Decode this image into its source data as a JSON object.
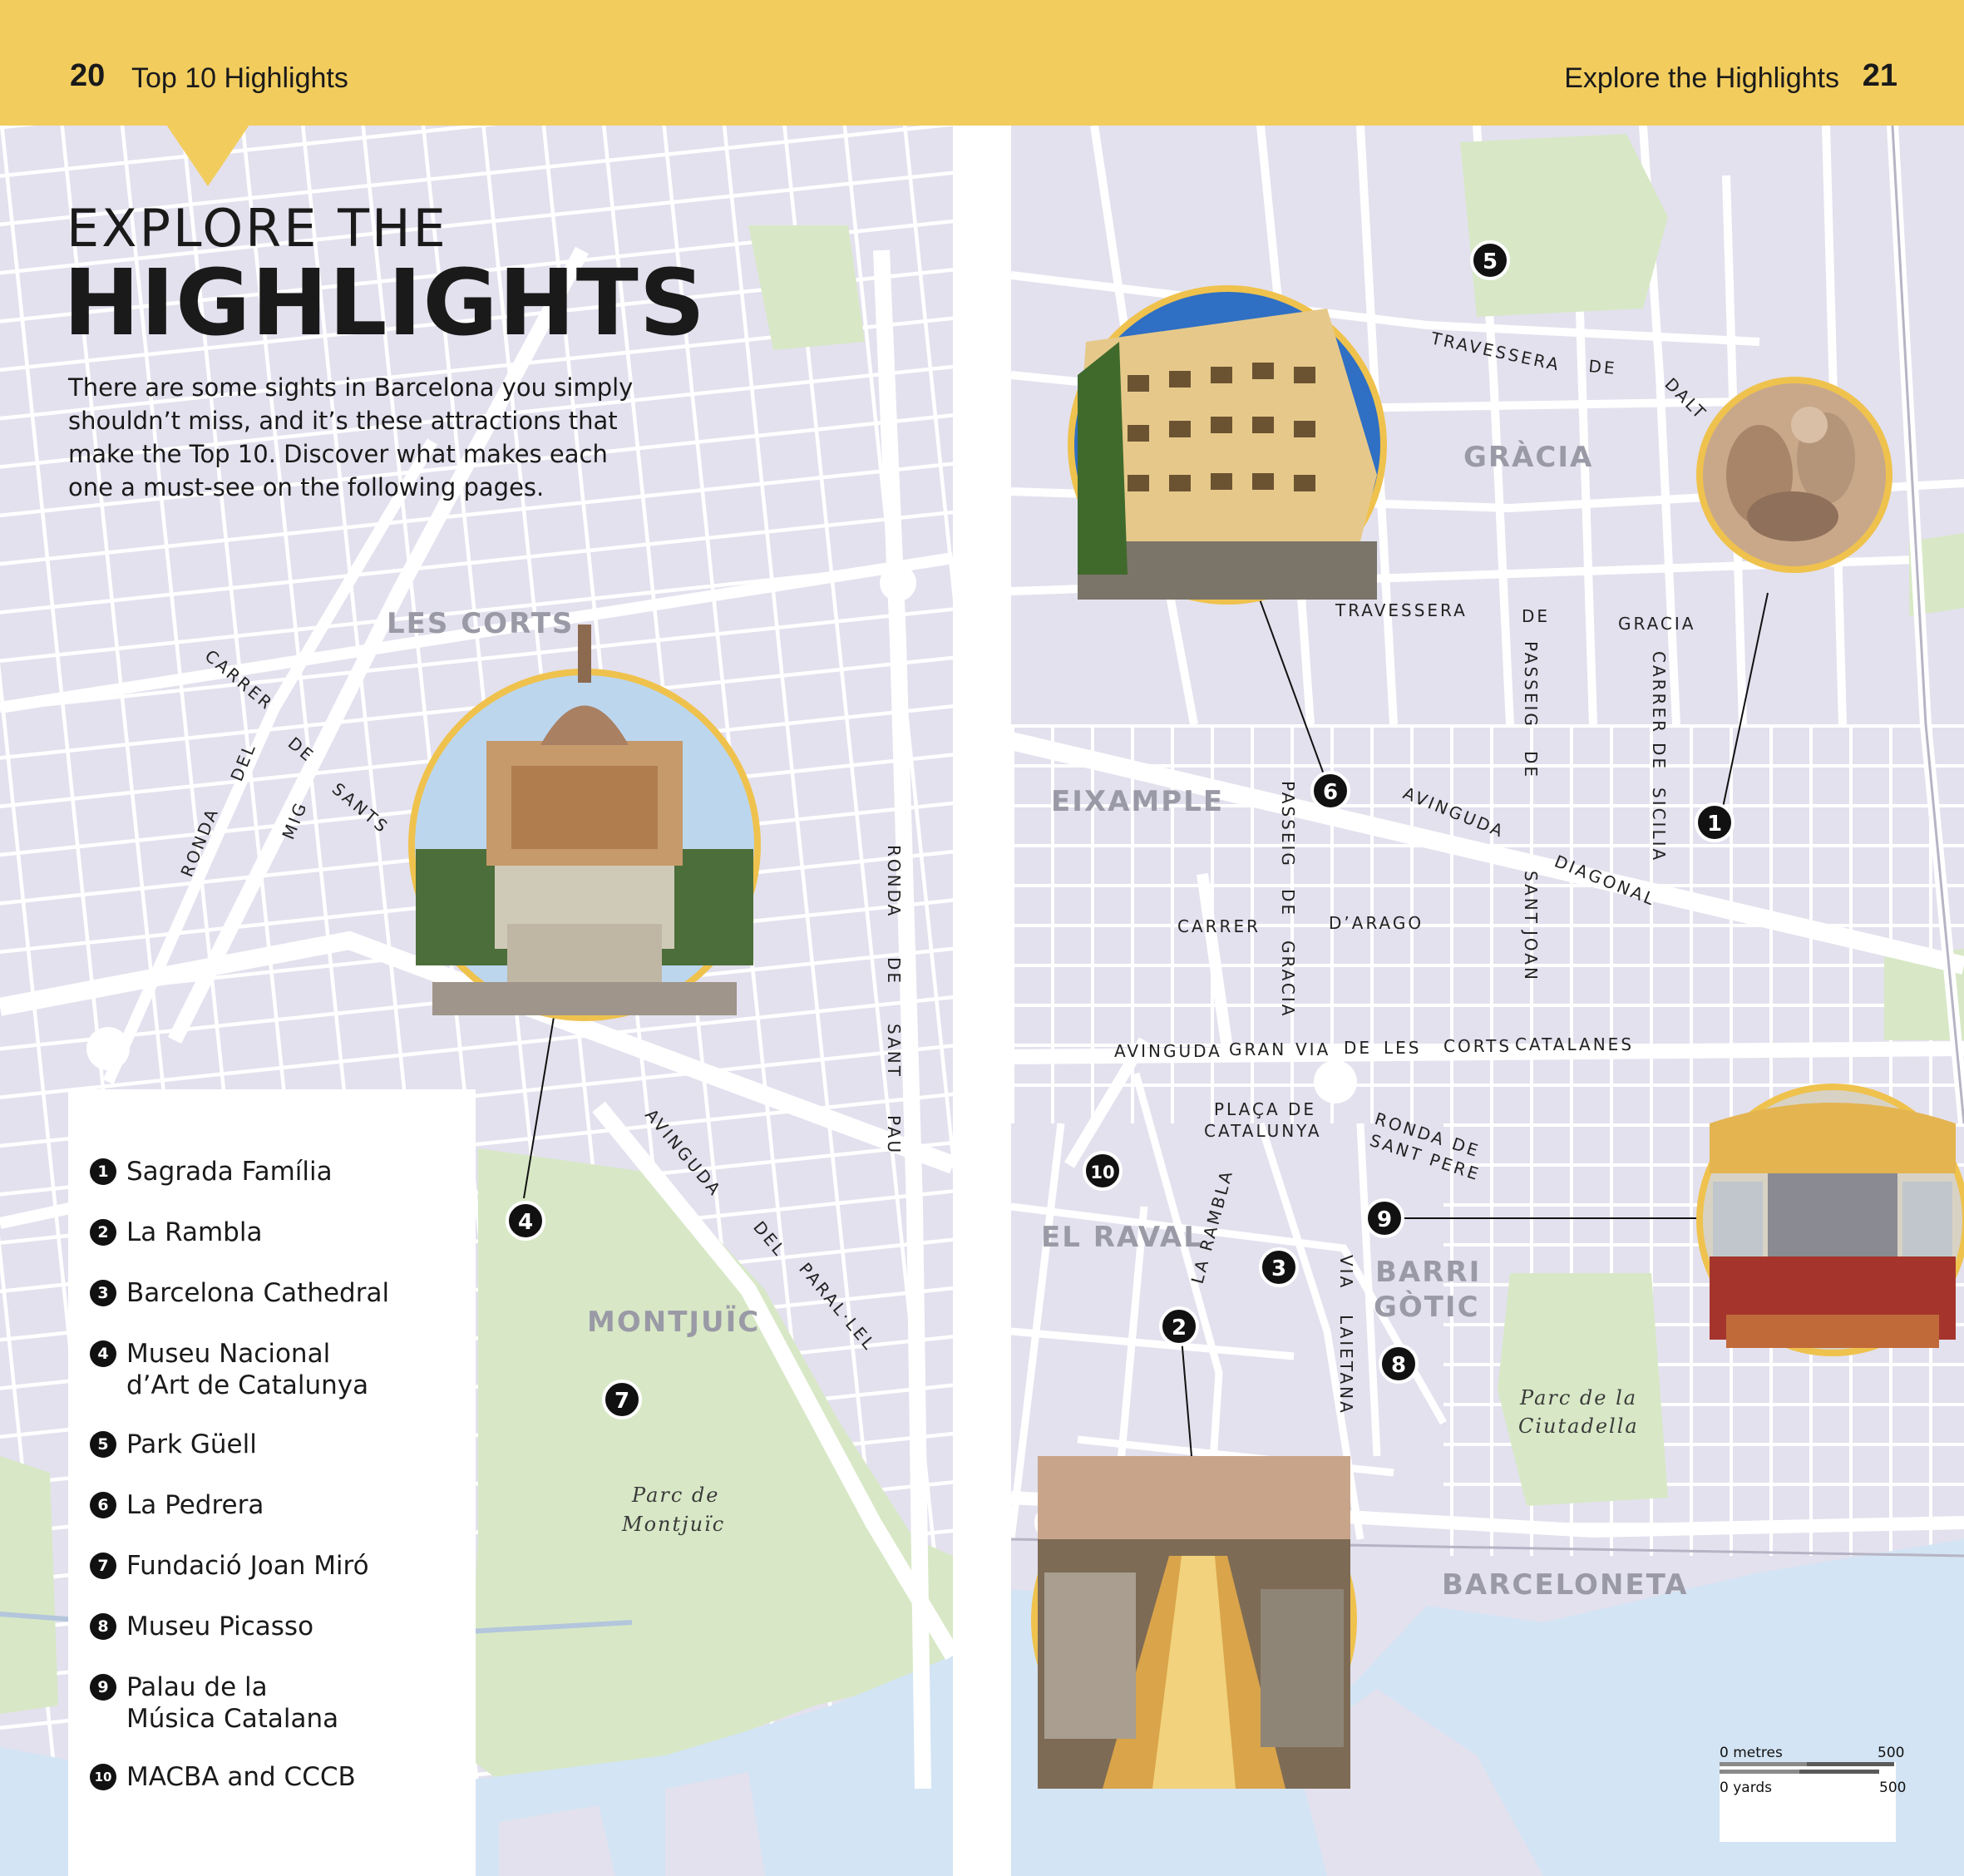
{
  "header": {
    "left_page_number": "20",
    "left_section": "Top 10 Highlights",
    "right_section": "Explore the Highlights",
    "right_page_number": "21"
  },
  "heading": {
    "line1": "EXPLORE THE",
    "line2": "HIGHLIGHTS"
  },
  "intro": "There are some sights in Barcelona you simply shouldn’t miss, and it’s these attractions that make the Top 10. Discover what makes each one a must-see on the following pages.",
  "highlights": [
    {
      "num": "1",
      "name": "Sagrada Família"
    },
    {
      "num": "2",
      "name": "La Rambla"
    },
    {
      "num": "3",
      "name": "Barcelona Cathedral"
    },
    {
      "num": "4",
      "name": "Museu Nacional d’Art de Catalunya"
    },
    {
      "num": "5",
      "name": "Park Güell"
    },
    {
      "num": "6",
      "name": "La Pedrera"
    },
    {
      "num": "7",
      "name": "Fundació Joan Miró"
    },
    {
      "num": "8",
      "name": "Museu Picasso"
    },
    {
      "num": "9",
      "name": "Palau de la Música Catalana"
    },
    {
      "num": "10",
      "name": "MACBA and CCCB"
    }
  ],
  "districts": {
    "les_corts": "LES CORTS",
    "montjuic": "MONTJUÏC",
    "gracia": "GRÀCIA",
    "eixample": "EIXAMPLE",
    "el_raval": "EL RAVAL",
    "barri_gotic_1": "BARRI",
    "barri_gotic_2": "GÒTIC",
    "barceloneta": "BARCELONETA"
  },
  "parks": {
    "montjuic_1": "Parc de",
    "montjuic_2": "Montjuïc",
    "ciutadella_1": "Parc de la",
    "ciutadella_2": "Ciutadella"
  },
  "streets": {
    "carrer_del_mig": [
      "CARRER",
      "DEL",
      "MIG"
    ],
    "ronda_del_mig": [
      "RONDA",
      "DEL"
    ],
    "de_sants": [
      "DE",
      "SANTS"
    ],
    "ronda_sant_pau": [
      "RONDA",
      "DE",
      "SANT",
      "PAU"
    ],
    "paral_lel": [
      "AVINGUDA",
      "DEL",
      "PARAL·LEL"
    ],
    "travessera_dalt": [
      "TRAVESSERA",
      "DE",
      "DALT"
    ],
    "travessera_gracia": [
      "TRAVESSERA",
      "DE",
      "GRACIA"
    ],
    "passeig_sant_joan": [
      "PASSEIG",
      "DE",
      "SANT",
      "JOAN"
    ],
    "carrer_sicilia": [
      "CARRER",
      "DE",
      "SICILIA"
    ],
    "passeig_gracia": [
      "PASSEIG",
      "DE",
      "GRACIA"
    ],
    "diagonal": [
      "AVINGUDA",
      "DIAGONAL"
    ],
    "arago": [
      "CARRER",
      "D’ARAGO"
    ],
    "gran_via": [
      "AVINGUDA",
      "GRAN",
      "VIA",
      "DE",
      "LES",
      "CORTS",
      "CATALANES"
    ],
    "placa_catalunya": [
      "PLAÇA DE",
      "CATALUNYA"
    ],
    "ronda_sant_pere": [
      "RONDA DE",
      "SANT PERE"
    ],
    "la_rambla": "LA RAMBLA",
    "via_laietana": [
      "VIA",
      "LAIETANA"
    ]
  },
  "scale": {
    "top_left": "0 metres",
    "top_right": "500",
    "bottom_left": "0 yards",
    "bottom_right": "500"
  },
  "colors": {
    "header": "#f2cd5e",
    "map_bg": "#e3e1ee",
    "road": "#ffffff",
    "park": "#d8e8c6",
    "water": "#d3e4f4",
    "marker": "#111111",
    "photo_ring": "#efc24e"
  },
  "photo_icons": [
    "la-pedrera-photo",
    "sagrada-familia-photo",
    "mnac-photo",
    "palau-musica-photo",
    "la-rambla-photo"
  ]
}
